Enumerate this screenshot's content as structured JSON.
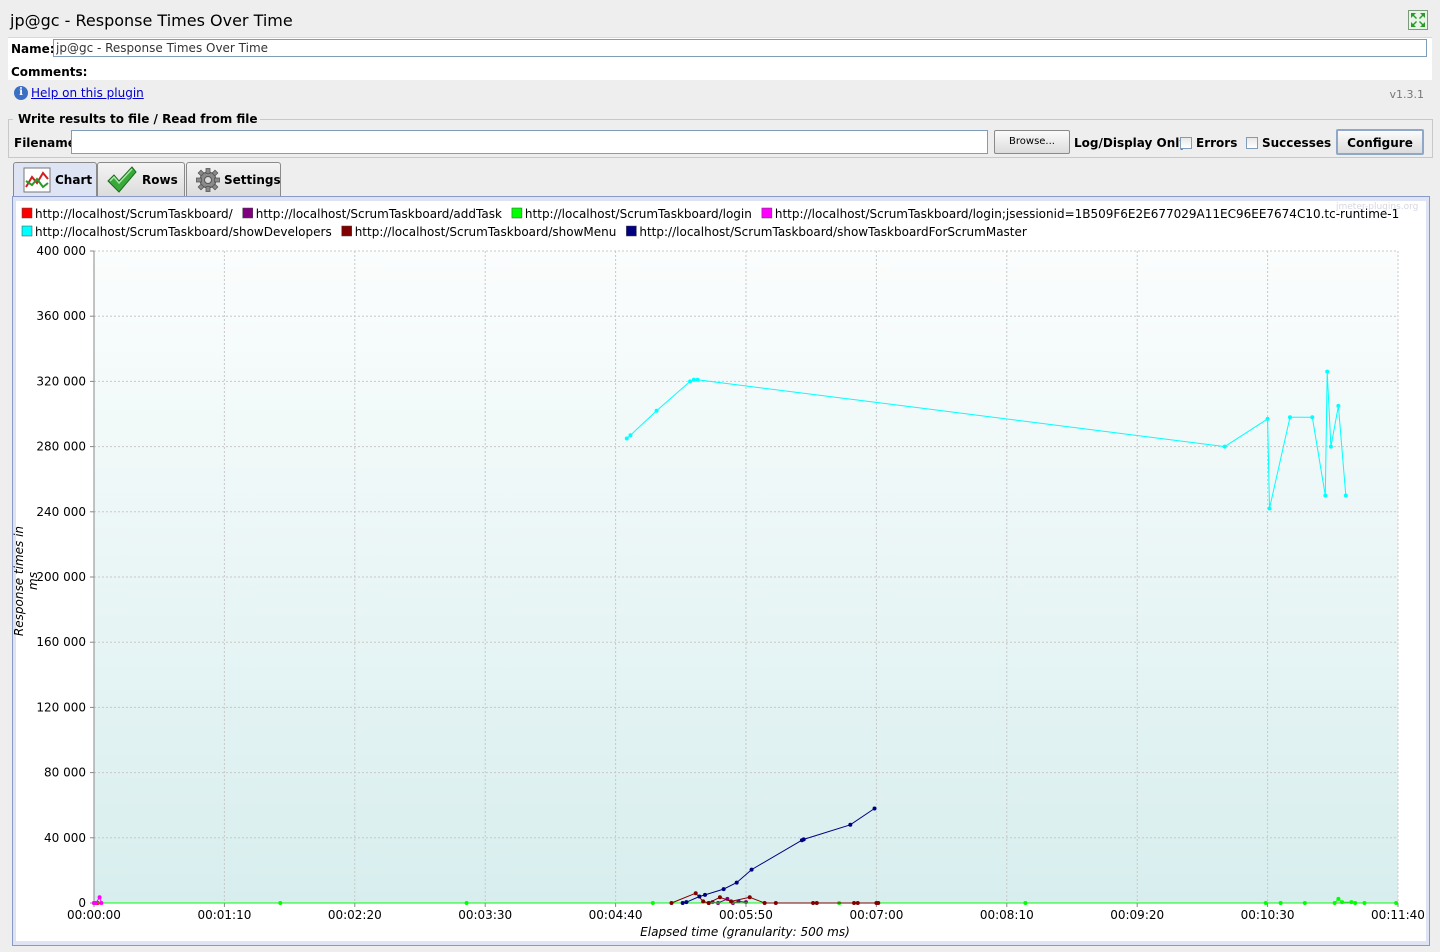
{
  "window": {
    "title": "jp@gc - Response Times Over Time",
    "expand_icon": "expand-icon"
  },
  "form": {
    "name_label": "Name:",
    "name_value": "jp@gc - Response Times Over Time",
    "comments_label": "Comments:",
    "help_link": "Help on this plugin",
    "version": "v1.3.1"
  },
  "file_panel": {
    "legend": "Write results to file / Read from file",
    "filename_label": "Filename",
    "filename_value": "",
    "browse_label": "Browse...",
    "log_display_label": "Log/Display Only:",
    "errors_label": "Errors",
    "errors_checked": false,
    "successes_label": "Successes",
    "successes_checked": false,
    "configure_label": "Configure"
  },
  "tabs": [
    {
      "label": "Chart",
      "icon": "chart-icon",
      "active": true
    },
    {
      "label": "Rows",
      "icon": "checkmark-icon",
      "active": false
    },
    {
      "label": "Settings",
      "icon": "gear-icon",
      "active": false
    }
  ],
  "watermark": "jmeter-plugins.org",
  "chart_data": {
    "type": "line",
    "ylabel": "Response times in ms",
    "xlabel": "Elapsed time (granularity: 500 ms)",
    "ylim": [
      0,
      400000
    ],
    "xlim_seconds": [
      0,
      700
    ],
    "yticks": [
      "400 000",
      "360 000",
      "320 000",
      "280 000",
      "240 000",
      "200 000",
      "160 000",
      "120 000",
      "80 000",
      "40 000",
      "0"
    ],
    "xticks": [
      "00:00:00",
      "00:01:10",
      "00:02:20",
      "00:03:30",
      "00:04:40",
      "00:05:50",
      "00:07:00",
      "00:08:10",
      "00:09:20",
      "00:10:30",
      "00:11:40"
    ],
    "grid": true,
    "legend_position": "top",
    "series": [
      {
        "name": "http://localhost/ScrumTaskboard/",
        "color": "#ff0000",
        "points": [
          [
            0,
            0
          ],
          [
            1,
            0
          ],
          [
            2,
            0
          ]
        ]
      },
      {
        "name": "http://localhost/ScrumTaskboard/addTask",
        "color": "#800080",
        "points": [
          [
            330,
            0
          ],
          [
            332,
            500
          ],
          [
            335,
            0
          ],
          [
            340,
            2500
          ],
          [
            343,
            0
          ],
          [
            346,
            1000
          ],
          [
            350,
            500
          ]
        ]
      },
      {
        "name": "http://localhost/ScrumTaskboard/login",
        "color": "#00ff00",
        "points": [
          [
            0,
            0
          ],
          [
            100,
            0
          ],
          [
            200,
            0
          ],
          [
            300,
            0
          ],
          [
            400,
            0
          ],
          [
            500,
            0
          ],
          [
            629,
            0
          ],
          [
            637,
            0
          ],
          [
            650,
            0
          ],
          [
            666,
            0
          ],
          [
            668,
            2500
          ],
          [
            670,
            500
          ],
          [
            675,
            500
          ],
          [
            677,
            0
          ],
          [
            682,
            0
          ],
          [
            699,
            0
          ]
        ]
      },
      {
        "name": "http://localhost/ScrumTaskboard/login;jsessionid=1B509F6E2E677029A11EC96EE7674C10.tc-runtime-1",
        "color": "#ff00ff",
        "points": [
          [
            0,
            0
          ],
          [
            1,
            0
          ],
          [
            3,
            3500
          ],
          [
            4,
            0
          ]
        ]
      },
      {
        "name": "http://localhost/ScrumTaskboard/showDevelopers",
        "color": "#00ffff",
        "points": [
          [
            286,
            285000
          ],
          [
            288,
            287000
          ],
          [
            302,
            302000
          ],
          [
            320,
            320000
          ],
          [
            322,
            321000
          ],
          [
            324,
            321000
          ],
          [
            607,
            280000
          ],
          [
            630,
            297000
          ],
          [
            631,
            242000
          ],
          [
            642,
            298000
          ],
          [
            654,
            298000
          ],
          [
            661,
            250000
          ],
          [
            662,
            326000
          ],
          [
            664,
            280000
          ],
          [
            668,
            305000
          ],
          [
            672,
            250000
          ]
        ]
      },
      {
        "name": "http://localhost/ScrumTaskboard/showMenu",
        "color": "#800000",
        "points": [
          [
            310,
            0
          ],
          [
            323,
            6000
          ],
          [
            327,
            1000
          ],
          [
            330,
            0
          ],
          [
            336,
            3500
          ],
          [
            342,
            1000
          ],
          [
            352,
            3500
          ],
          [
            360,
            0
          ],
          [
            366,
            0
          ],
          [
            386,
            0
          ],
          [
            388,
            0
          ],
          [
            408,
            0
          ],
          [
            410,
            0
          ],
          [
            420,
            0
          ],
          [
            421,
            0
          ]
        ]
      },
      {
        "name": "http://localhost/ScrumTaskboard/showTaskboardForScrumMaster",
        "color": "#000080",
        "points": [
          [
            316,
            0
          ],
          [
            318,
            500
          ],
          [
            325,
            4000
          ],
          [
            328,
            5000
          ],
          [
            338,
            8500
          ],
          [
            345,
            12500
          ],
          [
            353,
            20500
          ],
          [
            380,
            38500
          ],
          [
            381,
            39000
          ],
          [
            406,
            48000
          ],
          [
            419,
            58000
          ]
        ]
      }
    ]
  }
}
